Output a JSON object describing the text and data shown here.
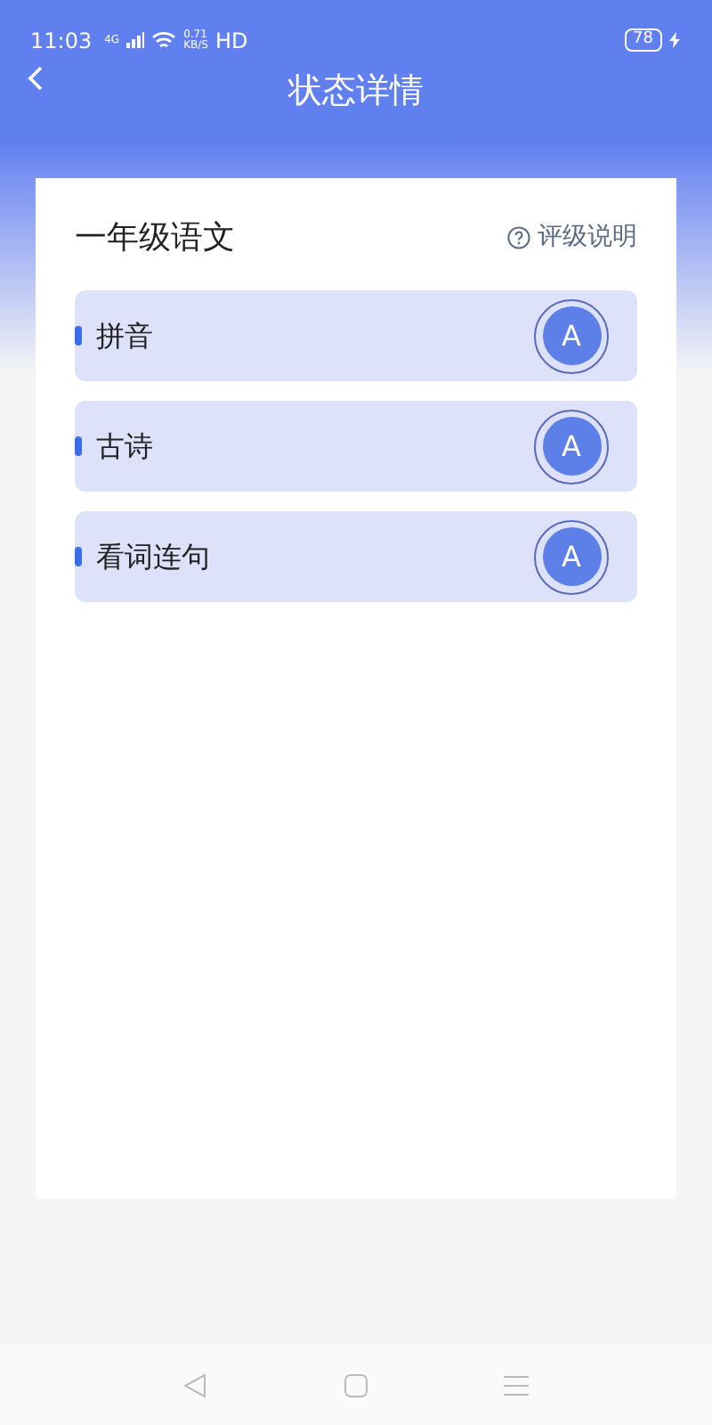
{
  "status_bar": {
    "time": "11:03",
    "network": "4G",
    "speed_value": "0.71",
    "speed_unit": "KB/S",
    "hd": "HD",
    "battery": "78"
  },
  "header": {
    "title": "状态详情"
  },
  "card": {
    "title": "一年级语文",
    "help_link": "评级说明",
    "items": [
      {
        "name": "拼音",
        "grade": "A"
      },
      {
        "name": "古诗",
        "grade": "A"
      },
      {
        "name": "看词连句",
        "grade": "A"
      }
    ]
  }
}
